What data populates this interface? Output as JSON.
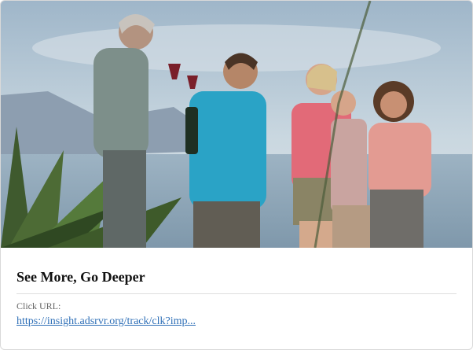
{
  "card": {
    "image_alt": "",
    "title": "See More, Go Deeper",
    "url_label": "Click URL:",
    "url_text": "https://insight.adsrvr.org/track/clk?imp..."
  }
}
